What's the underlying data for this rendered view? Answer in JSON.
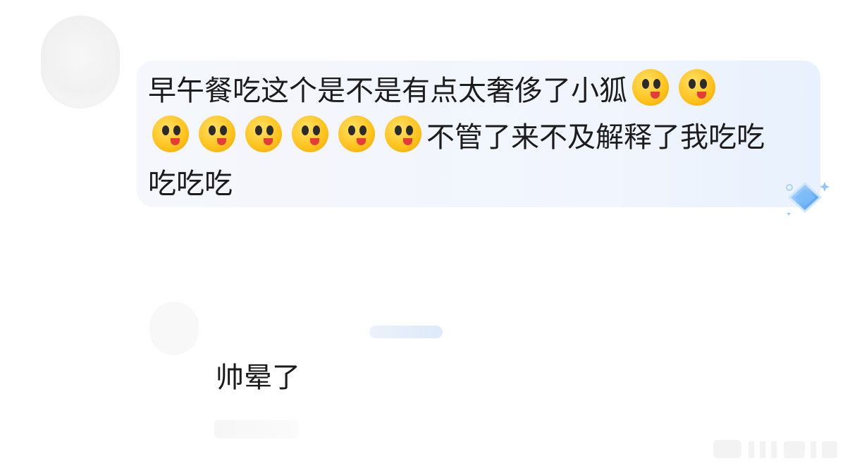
{
  "comment": {
    "text_line1": "早午餐吃这个是不是有点太奢侈了小狐",
    "text_line2_end": "不管了来不及解释了我吃吃",
    "text_line3": "吃吃吃",
    "emoji_name": "drooling-face-emoji"
  },
  "reply": {
    "text": "帅晕了"
  },
  "colors": {
    "bubble_bg": "#f3f6fc",
    "text": "#1c1c1c",
    "diamond_accent": "#5aa8f5"
  }
}
